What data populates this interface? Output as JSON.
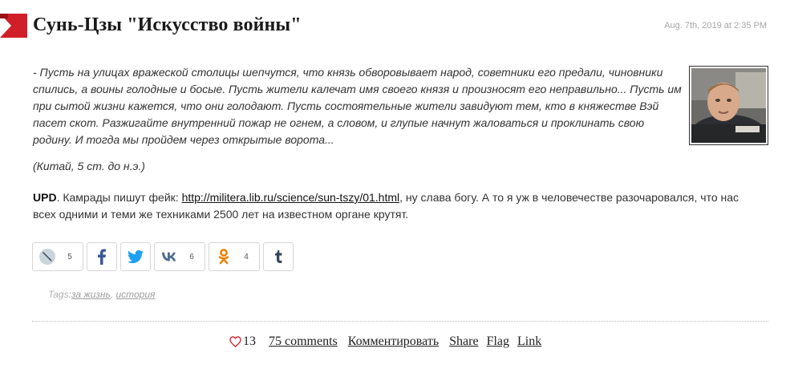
{
  "post": {
    "title": "Сунь-Цзы \"Искусство войны\"",
    "date": "Aug. 7th, 2019 at 2:35 PM",
    "quote": "- Пусть на улицах вражеской столицы шепчутся, что князь обворовывает народ, советники его предали, чиновники спились, а воины голодные и босые. Пусть жители калечат имя своего князя и произносят его неправильно... Пусть им при сытой жизни кажется, что они голодают. Пусть состоятельные жители завидуют тем, кто в княжестве Вэй пасет скот. Разжигайте внутренний пожар не огнем, а словом, и глупые начнут жаловаться и проклинать свою родину. И тогда мы пройдем через открытые ворота...",
    "source": "(Китай, 5 ст. до н.э.)",
    "upd_label": "UPD",
    "upd_text_before": ". Камрады пишут фейк: ",
    "upd_link": "http://militera.lib.ru/science/sun-tszy/01.html",
    "upd_text_after": ", ну слава богу. А то я уж в человечестве разочаровался, что нас всех одними и теми же техниками 2500 лет на известном органе крутят."
  },
  "share": [
    {
      "name": "livejournal",
      "icon": "lj-pencil-icon",
      "count": "5"
    },
    {
      "name": "facebook",
      "icon": "facebook-icon",
      "count": ""
    },
    {
      "name": "twitter",
      "icon": "twitter-icon",
      "count": ""
    },
    {
      "name": "vkontakte",
      "icon": "vk-icon",
      "count": "6"
    },
    {
      "name": "odnoklassniki",
      "icon": "ok-icon",
      "count": "4"
    },
    {
      "name": "tumblr",
      "icon": "tumblr-icon",
      "count": ""
    }
  ],
  "tags": {
    "label": "Tags:",
    "items": [
      "за жизнь",
      "история"
    ],
    "separator": ", "
  },
  "footer": {
    "likes": "13",
    "comments": "75 comments",
    "comment_action": "Комментировать",
    "share": "Share",
    "flag": "Flag",
    "link": "Link"
  },
  "colors": {
    "ribbon": "#d01f28",
    "facebook": "#3b5998",
    "twitter": "#1da1f2",
    "vk": "#4c6c91",
    "ok": "#ee8208",
    "tumblr": "#35465c",
    "heart": "#d01f28"
  }
}
